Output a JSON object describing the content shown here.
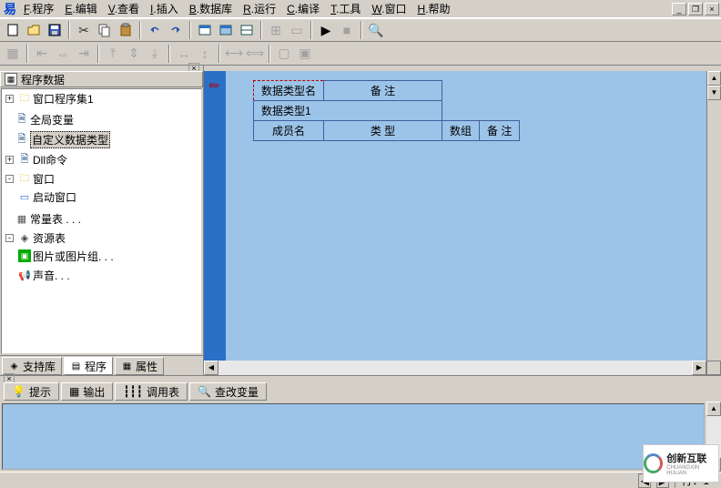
{
  "menu": {
    "items": [
      {
        "key": "F",
        "label": "程序"
      },
      {
        "key": "E",
        "label": "编辑"
      },
      {
        "key": "V",
        "label": "查看"
      },
      {
        "key": "I",
        "label": "插入"
      },
      {
        "key": "B",
        "label": "数据库"
      },
      {
        "key": "R",
        "label": "运行"
      },
      {
        "key": "C",
        "label": "编译"
      },
      {
        "key": "T",
        "label": "工具"
      },
      {
        "key": "W",
        "label": "窗口"
      },
      {
        "key": "H",
        "label": "帮助"
      }
    ]
  },
  "tree": {
    "header": "程序数据",
    "nodes": [
      {
        "toggle": "+",
        "icon": "folder",
        "label": "窗口程序集1"
      },
      {
        "toggle": "",
        "icon": "doc",
        "label": "全局变量"
      },
      {
        "toggle": "",
        "icon": "doc",
        "label": "自定义数据类型",
        "selected": true
      },
      {
        "toggle": "+",
        "icon": "doc",
        "label": "Dll命令"
      },
      {
        "toggle": "-",
        "icon": "folder",
        "label": "窗口",
        "children": [
          {
            "icon": "form",
            "label": "启动窗口"
          }
        ]
      },
      {
        "toggle": "",
        "icon": "doc",
        "label": "常量表 . . ."
      },
      {
        "toggle": "-",
        "icon": "res",
        "label": "资源表",
        "children": [
          {
            "icon": "img",
            "label": "图片或图片组. . ."
          },
          {
            "icon": "snd",
            "label": "声音. . ."
          }
        ]
      }
    ]
  },
  "panel_tabs": [
    {
      "label": "支持库",
      "icon": "◈"
    },
    {
      "label": "程序",
      "icon": "▤",
      "active": true
    },
    {
      "label": "属性",
      "icon": "▦"
    }
  ],
  "editor": {
    "table1": {
      "headers": [
        "数据类型名",
        "备 注"
      ],
      "row1": "数据类型1"
    },
    "table2": {
      "headers": [
        "成员名",
        "类 型",
        "数组",
        "备 注"
      ]
    }
  },
  "bottom_tabs": [
    {
      "label": "提示",
      "icon": "?",
      "color": "#d0a000",
      "active": true
    },
    {
      "label": "输出",
      "icon": "▦"
    },
    {
      "label": "调用表",
      "icon": "┇┇┇"
    },
    {
      "label": "查改变量",
      "icon": "🔍"
    }
  ],
  "status": {
    "line_label": "行：1"
  },
  "watermark": {
    "brand": "创新互联",
    "sub": "CHUANGXIN HULIAN"
  }
}
